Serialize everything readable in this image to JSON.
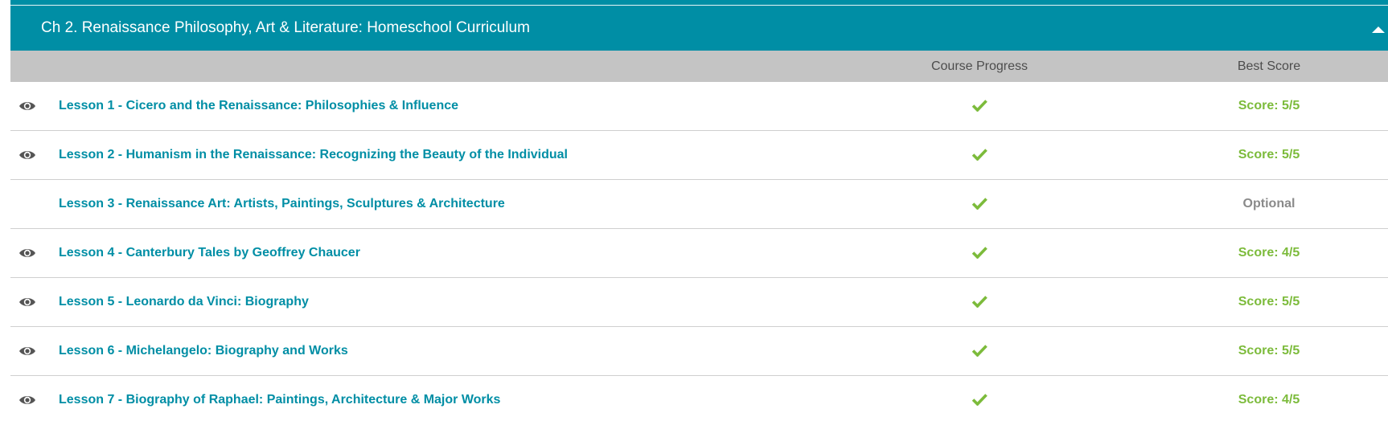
{
  "chapter": {
    "title": "Ch 2. Renaissance Philosophy, Art & Literature: Homeschool Curriculum",
    "collapse_icon": "triangle-up-icon"
  },
  "columns": {
    "progress": "Course Progress",
    "score": "Best Score"
  },
  "colors": {
    "accent": "#008ea5",
    "header_gray": "#c4c4c4",
    "complete_green": "#7cbb3b",
    "optional_gray": "#8a8a8a"
  },
  "lessons": [
    {
      "title": "Lesson 1 - Cicero and the Renaissance: Philosophies & Influence",
      "viewed": true,
      "complete": true,
      "score": "Score: 5/5"
    },
    {
      "title": "Lesson 2 - Humanism in the Renaissance: Recognizing the Beauty of the Individual",
      "viewed": true,
      "complete": true,
      "score": "Score: 5/5"
    },
    {
      "title": "Lesson 3 - Renaissance Art: Artists, Paintings, Sculptures & Architecture",
      "viewed": false,
      "complete": true,
      "score": "Optional"
    },
    {
      "title": "Lesson 4 - Canterbury Tales by Geoffrey Chaucer",
      "viewed": true,
      "complete": true,
      "score": "Score: 4/5"
    },
    {
      "title": "Lesson 5 - Leonardo da Vinci: Biography",
      "viewed": true,
      "complete": true,
      "score": "Score: 5/5"
    },
    {
      "title": "Lesson 6 - Michelangelo: Biography and Works",
      "viewed": true,
      "complete": true,
      "score": "Score: 5/5"
    },
    {
      "title": "Lesson 7 - Biography of Raphael: Paintings, Architecture & Major Works",
      "viewed": true,
      "complete": true,
      "score": "Score: 4/5"
    }
  ]
}
